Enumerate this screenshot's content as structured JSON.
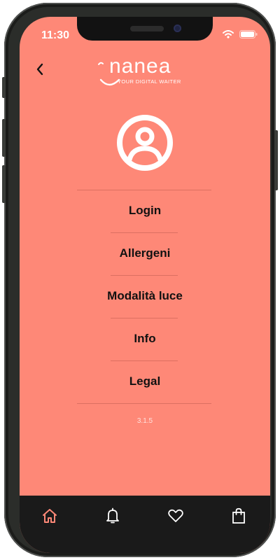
{
  "status_bar": {
    "time": "11:30"
  },
  "brand": {
    "name": "nanea",
    "tagline": "YOUR DIGITAL WAITER"
  },
  "menu": {
    "items": [
      {
        "label": "Login"
      },
      {
        "label": "Allergeni"
      },
      {
        "label": "Modalità luce"
      },
      {
        "label": "Info"
      },
      {
        "label": "Legal"
      }
    ]
  },
  "version": "3.1.5",
  "tab_bar": {
    "tabs": [
      {
        "icon": "home-icon",
        "active": true
      },
      {
        "icon": "bell-icon",
        "active": false
      },
      {
        "icon": "heart-icon",
        "active": false
      },
      {
        "icon": "shopping-bag-icon",
        "active": false
      }
    ]
  },
  "colors": {
    "background": "#fe8877",
    "tab_bar": "#1a1a1a",
    "active_tab": "#fe8877",
    "inactive_tab": "#ffffff"
  }
}
